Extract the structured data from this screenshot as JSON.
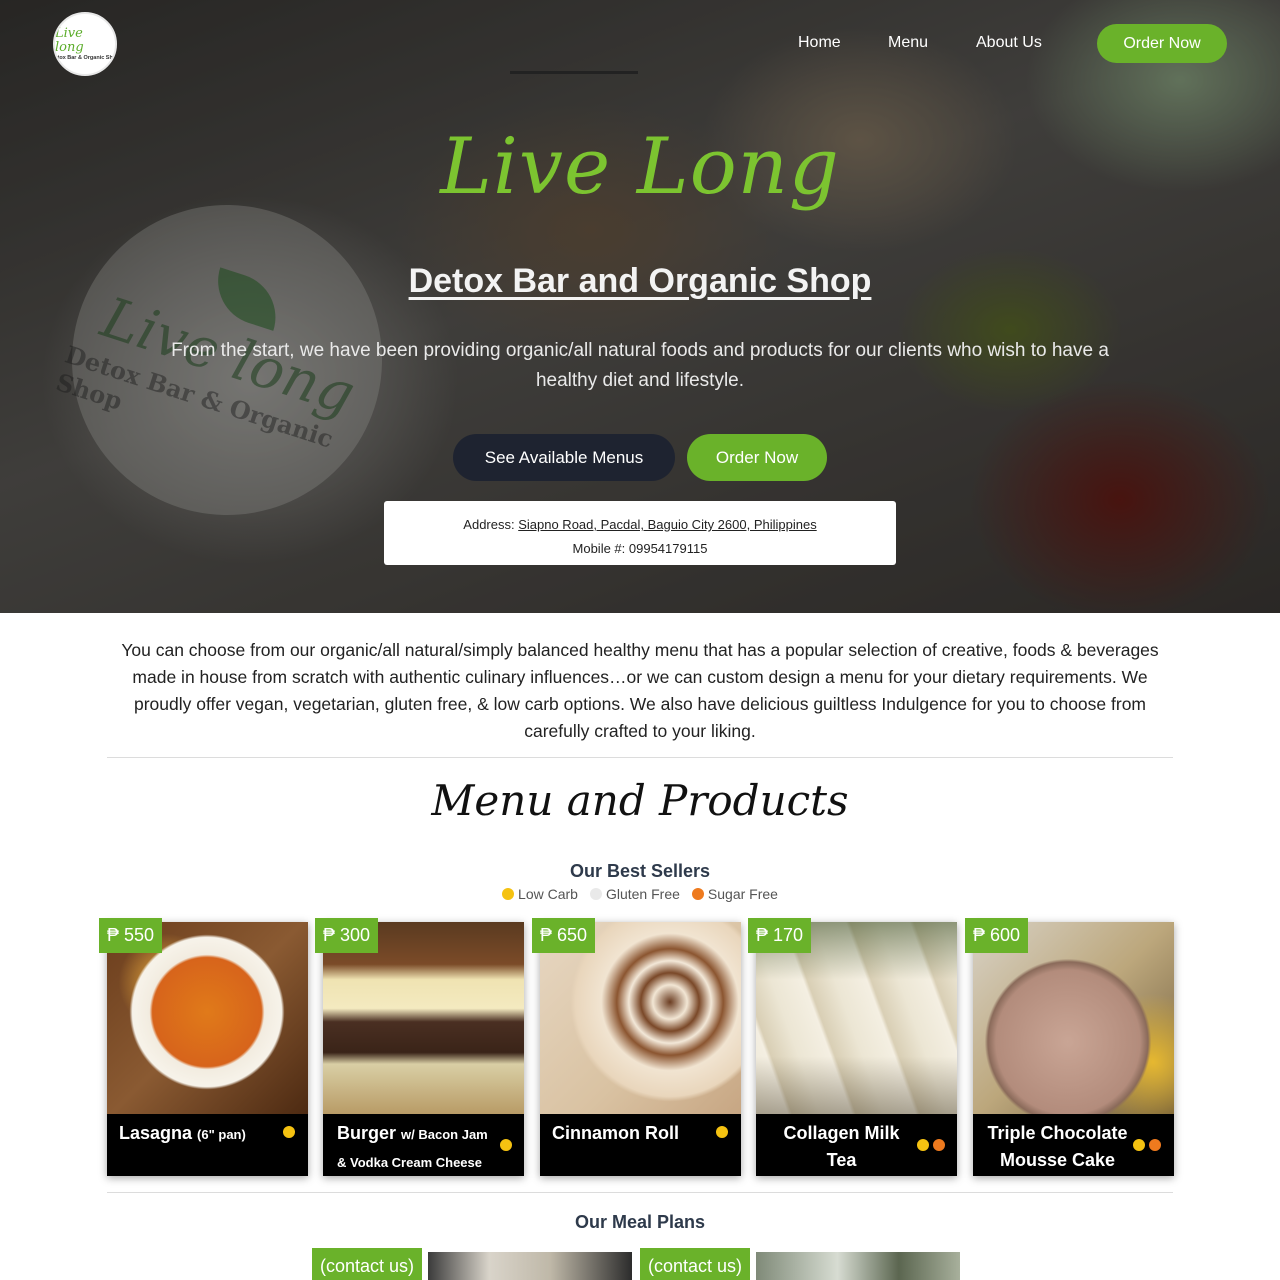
{
  "brand": {
    "logo_script": "Live long",
    "logo_sub": "Detox Bar & Organic Shop"
  },
  "nav": {
    "home": "Home",
    "menu": "Menu",
    "about": "About Us",
    "order": "Order Now"
  },
  "hero": {
    "title": "Live Long",
    "subtitle": "Detox Bar and Organic Shop",
    "description": "From the start, we have been providing organic/all natural foods and products for our clients who wish to have a healthy diet and lifestyle.",
    "btn_menus": "See Available Menus",
    "btn_order": "Order Now",
    "address_label": "Address: ",
    "address": "Siapno Road, Pacdal, Baguio City 2600, Philippines",
    "mobile_label": "Mobile #: ",
    "mobile": "09954179115"
  },
  "intro": "You can choose from our organic/all natural/simply balanced healthy menu that has a popular selection of creative, foods & beverages made in house from scratch with authentic culinary influences…or we can custom design a menu for your dietary requirements. We proudly offer vegan, vegetarian, gluten free, & low carb options. We also have delicious guiltless Indulgence for you to choose from carefully crafted to your liking.",
  "menu_section": {
    "title": "Menu and Products",
    "best_sellers": "Our Best Sellers",
    "legend": [
      {
        "label": "Low Carb",
        "color": "#f5c211"
      },
      {
        "label": "Gluten Free",
        "color": "#e9e9e9"
      },
      {
        "label": "Sugar Free",
        "color": "#ee7a1e"
      }
    ],
    "items": [
      {
        "price": "₱ 550",
        "name": "Lasagna",
        "name_extra": "(6\" pan)",
        "dots": [
          "#f5c211"
        ]
      },
      {
        "price": "₱ 300",
        "name": "Burger",
        "name_extra": "w/ Bacon Jam & Vodka Cream Cheese",
        "dots": [
          "#f5c211"
        ]
      },
      {
        "price": "₱ 650",
        "name": "Cinnamon Roll",
        "name_extra": "",
        "dots": [
          "#f5c211"
        ]
      },
      {
        "price": "₱ 170",
        "name": "Collagen Milk Tea",
        "name_extra": "",
        "dots": [
          "#f5c211",
          "#ee7a1e"
        ]
      },
      {
        "price": "₱ 600",
        "name": "Triple Chocolate Mousse Cake",
        "name_extra": "",
        "dots": [
          "#f5c211",
          "#ee7a1e"
        ]
      }
    ],
    "meal_plans": "Our Meal Plans",
    "meal_tags": [
      "(contact us)",
      "(contact us)"
    ]
  },
  "colors": {
    "accent": "#6ab22a",
    "dark_button": "#1e2330"
  }
}
